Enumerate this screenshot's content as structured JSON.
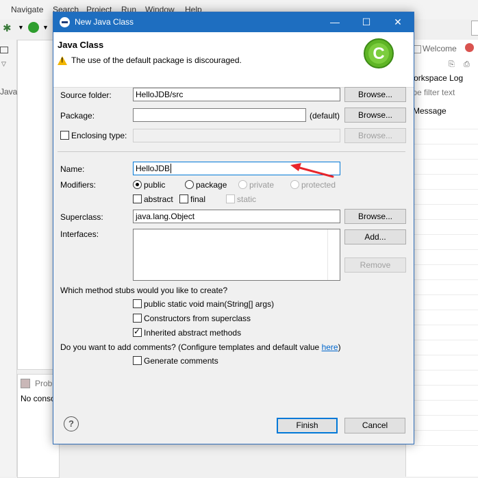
{
  "background": {
    "menu": [
      "Navigate",
      "Search",
      "Project",
      "Run",
      "Window",
      "Help"
    ],
    "left_strip_text": "Java",
    "problems_tab": "Prob",
    "problems_body": "No conso",
    "right_panel": {
      "tab_label": "Welcome",
      "log_title": "Workspace Log",
      "filter_placeholder": "type filter text",
      "column_header": "Message"
    }
  },
  "dialog": {
    "title": "New Java Class",
    "window_buttons": {
      "minimize": "—",
      "maximize": "☐",
      "close": "✕"
    },
    "banner": {
      "heading": "Java Class",
      "message": "The use of the default package is discouraged.",
      "logo_letter": "C"
    },
    "source_folder": {
      "label": "Source folder:",
      "value": "HelloJDB/src",
      "button": "Browse..."
    },
    "package": {
      "label": "Package:",
      "value": "",
      "hint": "(default)",
      "button": "Browse..."
    },
    "enclosing_type": {
      "label": "Enclosing type:",
      "checked": false,
      "value": "",
      "button": "Browse..."
    },
    "name": {
      "label": "Name:",
      "value": "HelloJDB"
    },
    "modifiers": {
      "label": "Modifiers:",
      "radios": [
        {
          "label": "public",
          "selected": true,
          "enabled": true
        },
        {
          "label": "package",
          "selected": false,
          "enabled": true
        },
        {
          "label": "private",
          "selected": false,
          "enabled": false
        },
        {
          "label": "protected",
          "selected": false,
          "enabled": false
        }
      ],
      "checks": [
        {
          "label": "abstract",
          "checked": false,
          "enabled": true
        },
        {
          "label": "final",
          "checked": false,
          "enabled": true
        },
        {
          "label": "static",
          "checked": false,
          "enabled": false
        }
      ]
    },
    "superclass": {
      "label": "Superclass:",
      "value": "java.lang.Object",
      "button": "Browse..."
    },
    "interfaces": {
      "label": "Interfaces:",
      "add_button": "Add...",
      "remove_button": "Remove"
    },
    "stubs": {
      "question": "Which method stubs would you like to create?",
      "options": [
        {
          "label": "public static void main(String[] args)",
          "checked": false
        },
        {
          "label": "Constructors from superclass",
          "checked": false
        },
        {
          "label": "Inherited abstract methods",
          "checked": true
        }
      ]
    },
    "comments": {
      "question_prefix": "Do you want to add comments? (Configure templates and default value ",
      "link": "here",
      "question_suffix": ")",
      "option": {
        "label": "Generate comments",
        "checked": false
      }
    },
    "footer": {
      "help": "?",
      "finish": "Finish",
      "cancel": "Cancel"
    },
    "colors": {
      "titlebar": "#1e6ec0",
      "focus": "#0078d7",
      "annotation_arrow": "#e8262b"
    }
  }
}
